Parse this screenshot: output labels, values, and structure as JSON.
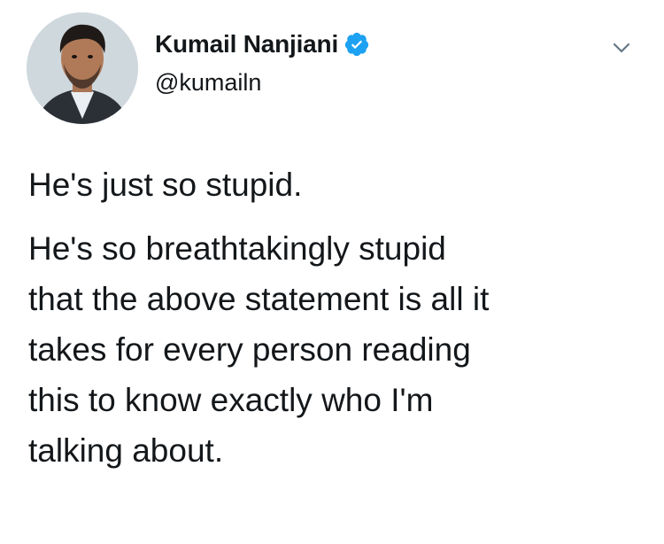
{
  "author": {
    "display_name": "Kumail Nanjiani",
    "handle": "@kumailn",
    "verified": true,
    "avatar_icon": "profile-photo",
    "verified_icon": "verified-badge-icon",
    "verified_color": "#1da1f2"
  },
  "menu": {
    "icon": "chevron-down-icon"
  },
  "tweet": {
    "paragraph_1": "He's just so stupid.",
    "paragraph_2_lines": [
      "He's so breathtakingly stupid",
      "that the above statement is all it",
      "takes for every person reading",
      "this to know exactly who I'm",
      "talking about."
    ]
  },
  "colors": {
    "text": "#14171a",
    "background": "#ffffff",
    "chevron": "#657786"
  }
}
